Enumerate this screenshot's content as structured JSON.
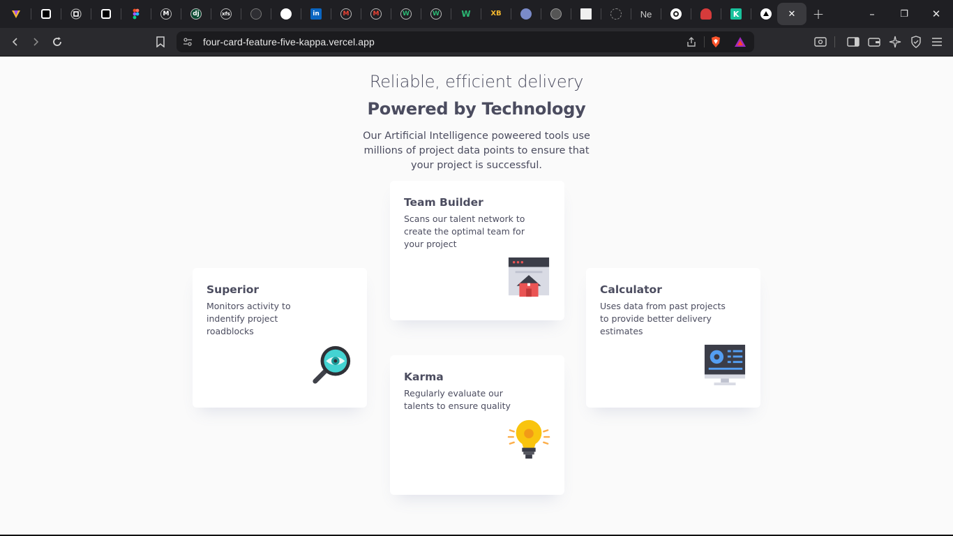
{
  "browser": {
    "tab_title_partial": "Ne",
    "new_tab_label": "+",
    "url": "four-card-feature-five-kappa.vercel.app",
    "window_controls": {
      "minimize": "–",
      "maximize": "❐",
      "close": "✕"
    },
    "tab_icons": [
      "vivaldi-icon",
      "square-icon",
      "circle-square-icon",
      "square-icon",
      "figma-icon",
      "medium-icon",
      "django-icon",
      "xfs-icon",
      "circle-icon",
      "white-circle-icon",
      "linkedin-icon",
      "gmail-icon",
      "gmail-icon",
      "w-icon",
      "w-icon",
      "webflow-icon",
      "xb-icon",
      "avatar-icon",
      "github-icon",
      "image-icon",
      "loading-icon",
      "ne-tab",
      "openai-icon",
      "mushroom-icon",
      "k-icon",
      "vercel-icon"
    ]
  },
  "header": {
    "subtitle": "Reliable, efficient delivery",
    "title": "Powered by Technology",
    "intro": "Our Artificial Intelligence poweered tools use millions of project data points to ensure that your project is successful."
  },
  "cards": [
    {
      "title": "Superior",
      "description": "Monitors activity to indentify project roadblocks",
      "icon": "magnifier-eye-icon",
      "accent": "#44d3d2"
    },
    {
      "title": "Team Builder",
      "description": "Scans our talent network to create the optimal team for your project",
      "icon": "team-builder-icon",
      "accent": "#ea5454"
    },
    {
      "title": "Karma",
      "description": "Regularly evaluate our talents to ensure quality",
      "icon": "lightbulb-icon",
      "accent": "#fcae4a"
    },
    {
      "title": "Calculator",
      "description": "Uses data from past projects to provide better delivery estimates",
      "icon": "calculator-monitor-icon",
      "accent": "#549ef2"
    }
  ]
}
